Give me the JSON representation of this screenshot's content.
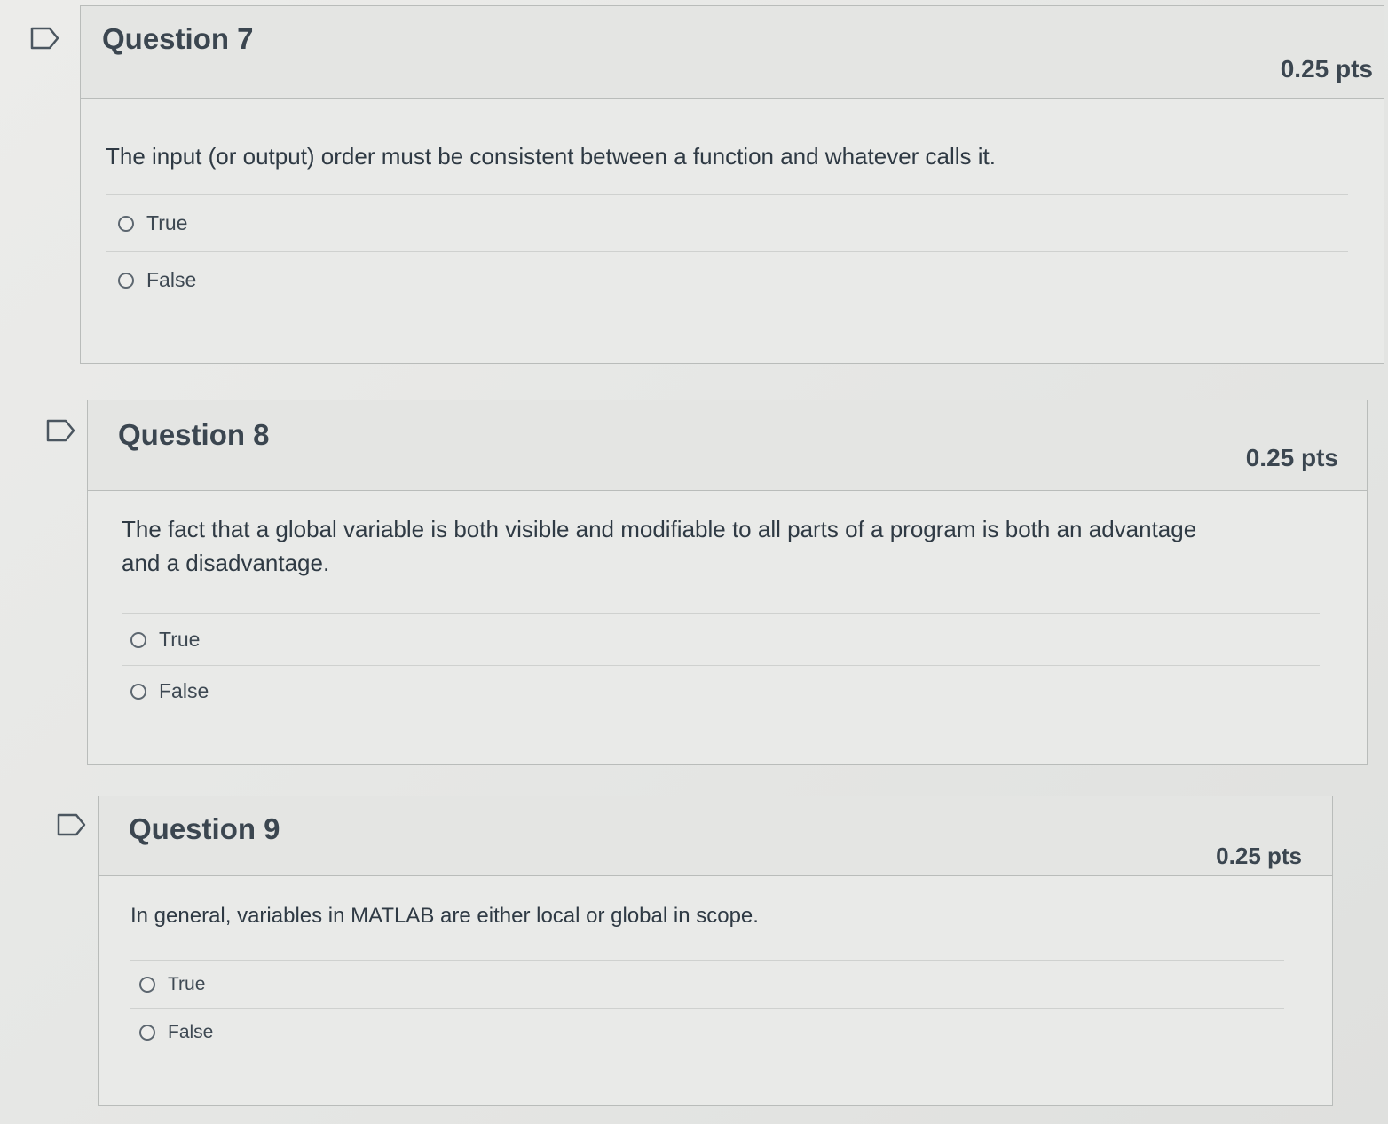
{
  "questions": [
    {
      "title": "Question 7",
      "points": "0.25 pts",
      "text": "The input (or output) order must be consistent between a function and whatever calls it.",
      "options": [
        "True",
        "False"
      ]
    },
    {
      "title": "Question 8",
      "points": "0.25 pts",
      "text": "The fact that a global variable is both visible and modifiable to all parts of a program is both an advantage and a disadvantage.",
      "options": [
        "True",
        "False"
      ]
    },
    {
      "title": "Question 9",
      "points": "0.25 pts",
      "text": "In general, variables in MATLAB are either local or global in scope.",
      "options": [
        "True",
        "False"
      ]
    }
  ],
  "icons": {
    "flag": "flag-question-icon"
  }
}
